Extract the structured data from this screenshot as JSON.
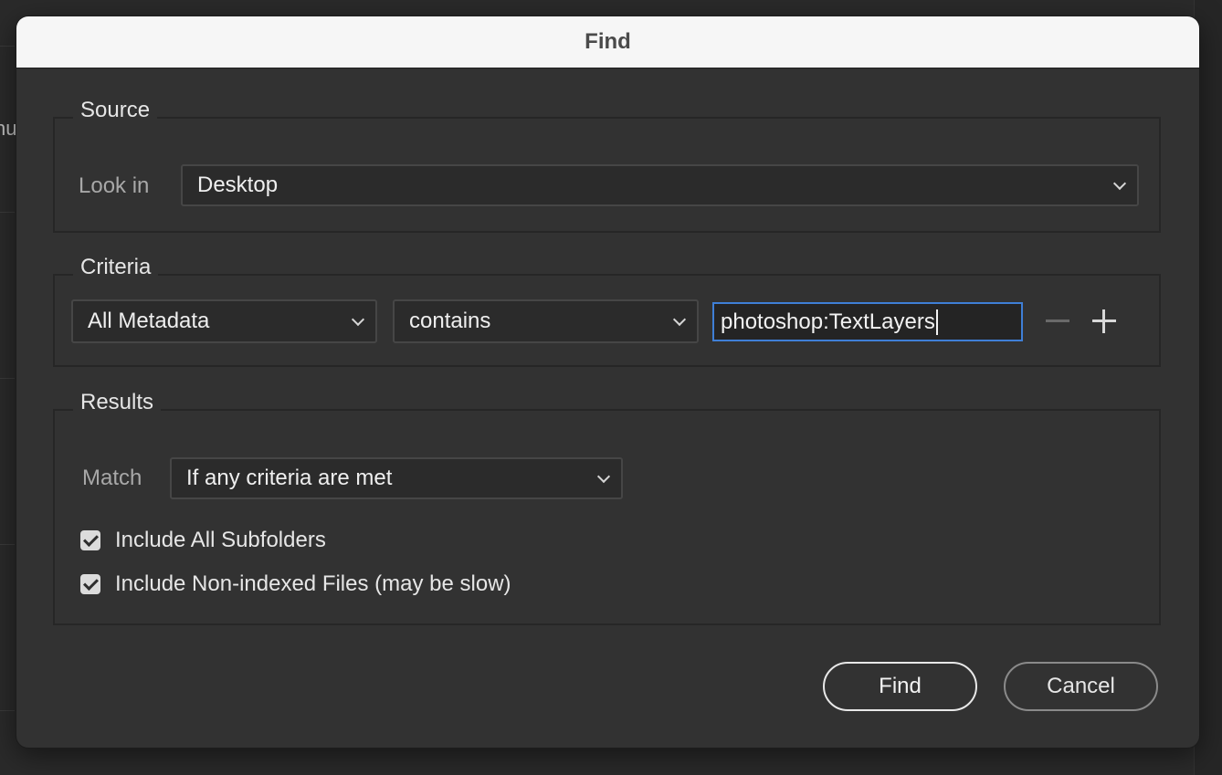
{
  "dialog": {
    "title": "Find"
  },
  "background": {
    "left_fragment": "nu"
  },
  "source": {
    "legend": "Source",
    "look_in_label": "Look in",
    "look_in_value": "Desktop"
  },
  "criteria": {
    "legend": "Criteria",
    "field_value": "All Metadata",
    "operator_value": "contains",
    "text_value": "photoshop:TextLayers",
    "remove_icon": "minus-icon",
    "add_icon": "plus-icon"
  },
  "results": {
    "legend": "Results",
    "match_label": "Match",
    "match_value": "If any criteria are met",
    "include_subfolders_label": "Include All Subfolders",
    "include_subfolders_checked": true,
    "include_nonindexed_label": "Include Non-indexed Files (may be slow)",
    "include_nonindexed_checked": true
  },
  "buttons": {
    "find": "Find",
    "cancel": "Cancel"
  },
  "colors": {
    "focus_ring": "#3f7fd6",
    "dialog_bg": "#323232",
    "title_bg": "#f6f6f6"
  }
}
